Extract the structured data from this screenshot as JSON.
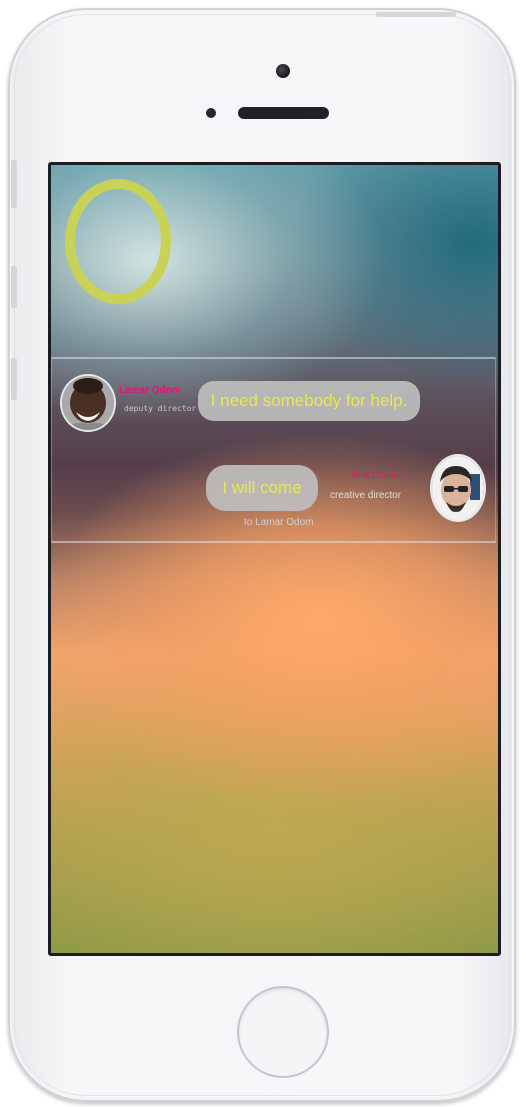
{
  "chat": {
    "messages": [
      {
        "sender": "Lamar Odom",
        "role": "deputy director",
        "text": "I need somebody for help."
      },
      {
        "sender": "Rick Charles",
        "role": "creative director",
        "text": "I will come",
        "recipient": "to Lamar Odom"
      }
    ]
  },
  "colors": {
    "ring": "#c9d257",
    "sender_name": "#e8117a",
    "bubble_text": "#e8e84f",
    "bubble_background": "#bebebe"
  },
  "icons": {
    "status_ring": "ring-icon"
  }
}
